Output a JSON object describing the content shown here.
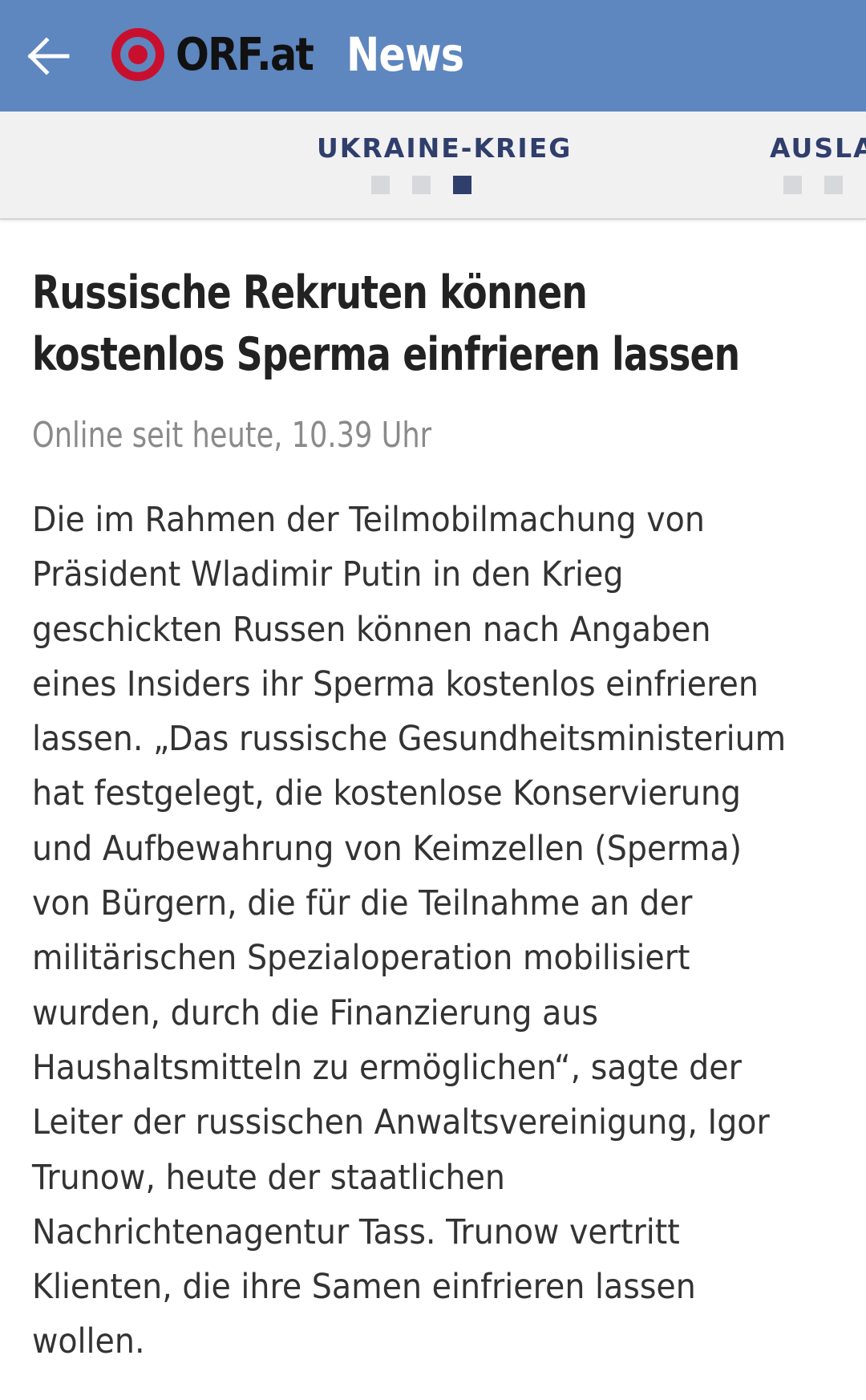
{
  "appbar": {
    "back_icon": "arrow-left-icon",
    "logo_text": "ORF.at",
    "section_title": "News",
    "colors": {
      "bar": "#5e86bf",
      "logo_red": "#c8102e"
    }
  },
  "categories": {
    "active_label": "UKRAINE-KRIEG",
    "next_label": "AUSLA",
    "active_dots": {
      "count": 3,
      "active_index": 2
    },
    "next_dots": {
      "count": 2,
      "active_index": -1
    },
    "colors": {
      "label": "#2f3e6b",
      "dot_inactive": "#d7d8dc",
      "dot_active": "#2f3e6b"
    }
  },
  "article": {
    "headline": "Russische Rekruten können kostenlos Sperma einfrieren lassen",
    "dateline": "Online seit heute, 10.39 Uhr",
    "body": "Die im Rahmen der Teilmobilmachung von Präsident Wladimir Putin in den Krieg geschickten Russen können nach Angaben eines Insiders ihr Sperma kostenlos einfrieren lassen. „Das russische Gesundheitsministerium hat festgelegt, die kostenlose Konservierung und Aufbewahrung von Keimzellen (Sperma) von Bürgern, die für die Teilnahme an der militärischen Spezialoperation mobilisiert wurden, durch die Finanzierung aus Haushaltsmitteln zu ermöglichen“, sagte der Leiter der russischen Anwaltsvereinigung, Igor Trunow, heute der staatlichen Nachrichtenagentur Tass. Trunow vertritt Klienten, die ihre Samen einfrieren lassen wollen."
  }
}
